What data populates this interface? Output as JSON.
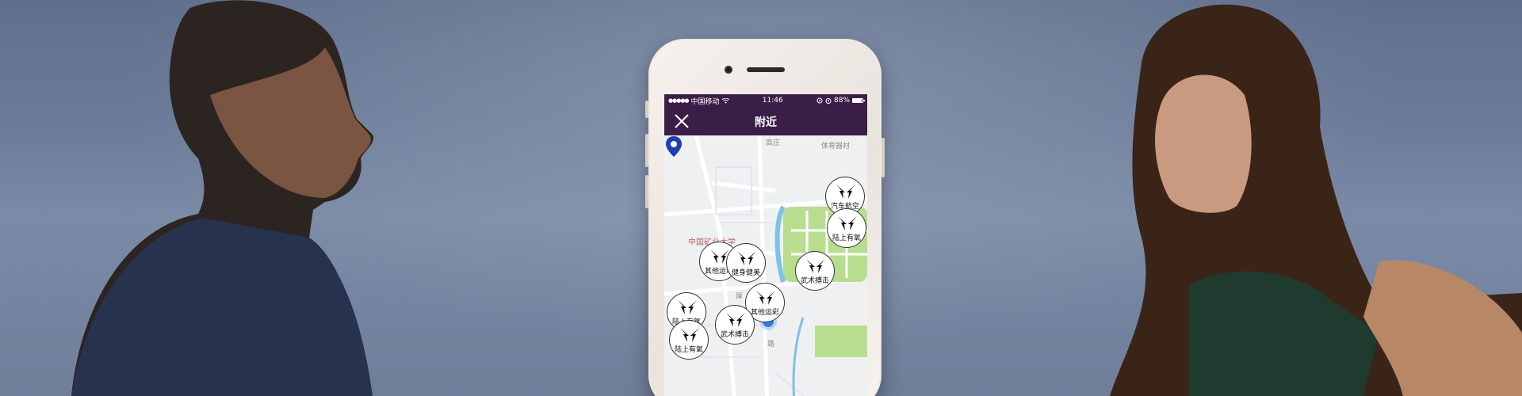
{
  "phone": {
    "status_bar": {
      "signal": "●●●●●",
      "carrier": "中国移动",
      "time": "11:46",
      "battery": "88%",
      "battery_level": 0.88
    },
    "nav": {
      "title": "附近"
    },
    "map": {
      "labels": [
        "高庄",
        "体育器材",
        "中国矿业大学",
        "厚",
        "路"
      ],
      "markers": [
        {
          "label": "汽车航空"
        },
        {
          "label": "陆上有氧"
        },
        {
          "label": "其他运动"
        },
        {
          "label": "健身健美"
        },
        {
          "label": "武术搏击"
        },
        {
          "label": "其他运彩"
        },
        {
          "label": "陆上有氧"
        },
        {
          "label": "武术搏击"
        },
        {
          "label": "陆上有氧"
        }
      ]
    }
  },
  "colors": {
    "brand": "#3b1e47",
    "pin": "#1f3fb0",
    "location": "#2a7fe0",
    "park": "#b9dd8f",
    "water": "#7fc1e8"
  }
}
